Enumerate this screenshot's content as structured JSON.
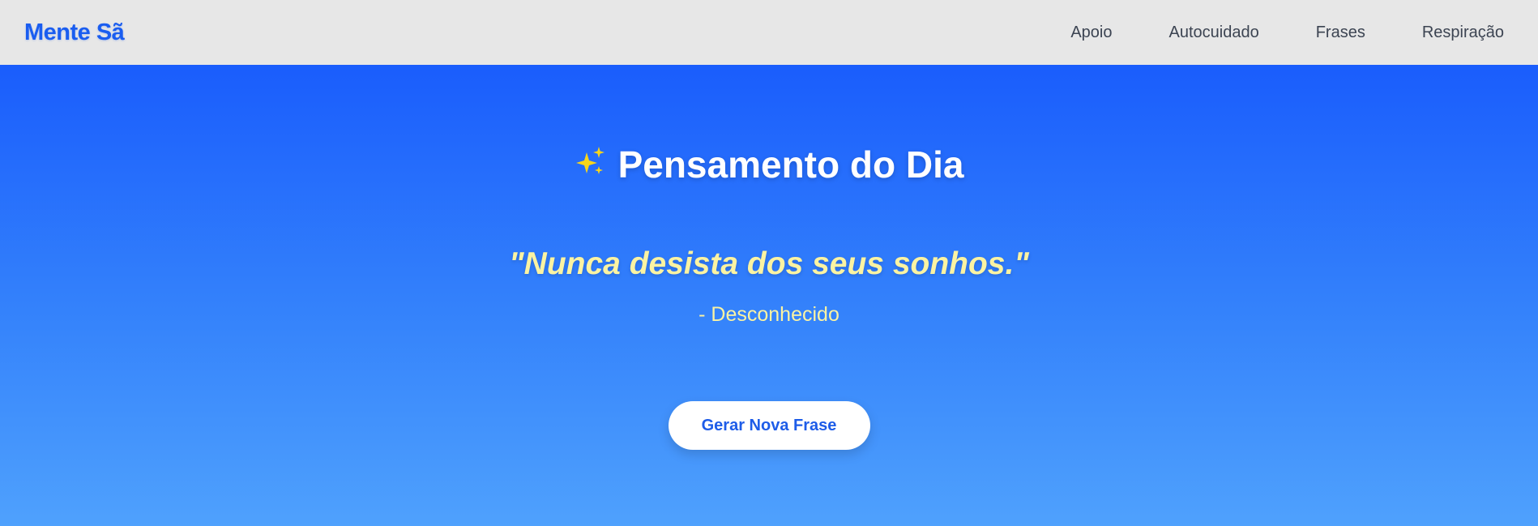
{
  "header": {
    "brand": "Mente Sã",
    "nav": [
      "Apoio",
      "Autocuidado",
      "Frases",
      "Respiração"
    ]
  },
  "hero": {
    "icon": "sparkles-icon",
    "title": "Pensamento do Dia",
    "quote": "\"Nunca desista dos seus sonhos.\"",
    "author": "- Desconhecido",
    "button_label": "Gerar Nova Frase"
  },
  "colors": {
    "brand": "#1a5df0",
    "header_bg": "#e7e7e7",
    "gradient_top": "#1a5dfc",
    "gradient_bottom": "#4fa1fd",
    "quote": "#fbf3a2",
    "sparkle": "#f7d51b"
  }
}
